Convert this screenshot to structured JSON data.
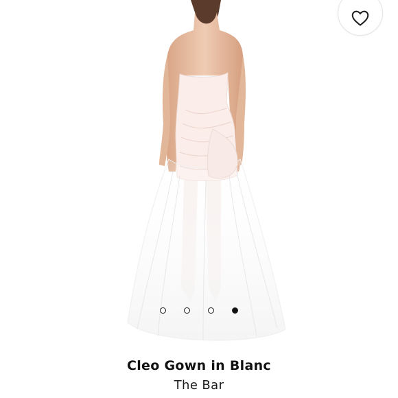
{
  "product": {
    "title": "Cleo Gown in Blanc",
    "brand": "The Bar"
  },
  "gallery": {
    "slide_count": 4,
    "active_index": 3,
    "image_subject": "model-back-view-white-strapless-gown-with-tulle-train"
  },
  "wishlist": {
    "icon": "heart-outline-icon"
  },
  "colors": {
    "accent": "#111111",
    "gown": "#fbeeea",
    "skin": "#e8bfa3"
  }
}
